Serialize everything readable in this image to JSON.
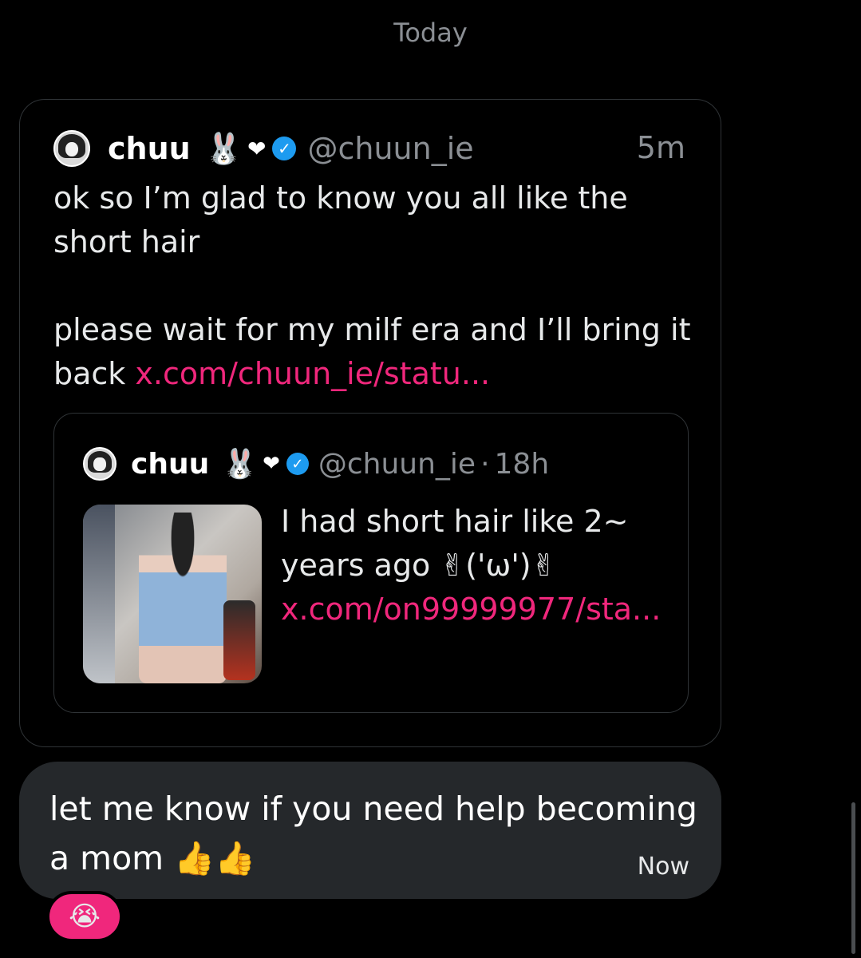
{
  "date_separator": "Today",
  "shared_tweet": {
    "display_name": "chuu",
    "name_emojis": [
      "🐰",
      "❤"
    ],
    "verified_icon": "verified-badge-icon",
    "handle": "@chuun_ie",
    "time": "5m",
    "text_line1": "ok so I’m glad to know you all like the short hair",
    "text_line2": "please wait for my milf era and I’ll bring it back",
    "link": "x.com/chuun_ie/statu...",
    "quoted_tweet": {
      "display_name": "chuu",
      "name_emojis": [
        "🐰",
        "❤"
      ],
      "handle": "@chuun_ie",
      "separator": "·",
      "time": "18h",
      "text": "I had short hair like 2~ years ago ✌('ω')✌",
      "link": "x.com/on99999977/sta...",
      "media": "photo-thumbnail"
    }
  },
  "reply_message": {
    "text": "let me know if you need help becoming a mom",
    "emojis": "👍👍",
    "time": "Now",
    "reaction": "😭"
  },
  "colors": {
    "background": "#000000",
    "link": "#f0277c",
    "bubble": "#25282b",
    "muted_text": "#8b8f94",
    "verified": "#1d9bf0"
  }
}
